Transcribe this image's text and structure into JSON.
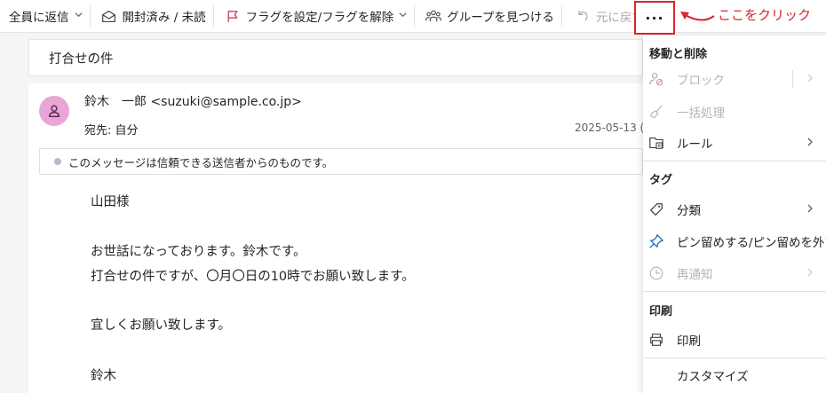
{
  "toolbar": {
    "reply_all": "全員に返信",
    "mark_read": "開封済み / 未読",
    "flag": "フラグを設定/フラグを解除",
    "find_groups": "グループを見つける",
    "undo": "元に戻す",
    "more": "···"
  },
  "annotation": {
    "text": "ここをクリック",
    "color": "#d8262b"
  },
  "message": {
    "subject": "打合せの件",
    "sender": "鈴木　一郎 <suzuki@sample.co.jp>",
    "to": "宛先: 自分",
    "date": "2025-05-13 (",
    "trust_notice": "このメッセージは信頼できる送信者からのものです。",
    "body": [
      "山田様",
      "お世話になっております。鈴木です。",
      "打合せの件ですが、〇月〇日の10時でお願い致します。",
      "宜しくお願い致します。",
      "鈴木"
    ]
  },
  "menu": {
    "section_move_delete": "移動と削除",
    "block": "ブロック",
    "sweep": "一括処理",
    "rules": "ルール",
    "section_tags": "タグ",
    "categorize": "分類",
    "pin": "ピン留めする/ピン留めを外す",
    "snooze": "再通知",
    "section_print": "印刷",
    "print": "印刷",
    "customize": "カスタマイズ"
  },
  "colors": {
    "accent": "#0f6cbd",
    "highlight_red": "#d8262b",
    "avatar": "#e9a5d6"
  }
}
